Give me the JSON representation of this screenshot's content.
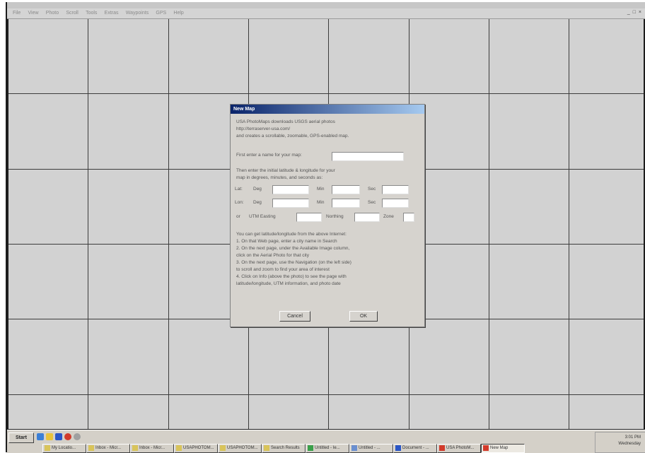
{
  "window": {
    "menu": [
      "File",
      "View",
      "Photo",
      "Scroll",
      "Tools",
      "Extras",
      "Waypoints",
      "GPS",
      "Help"
    ],
    "controls": "_ □ ×"
  },
  "dialog": {
    "title": "New Map",
    "intro": [
      "USA PhotoMaps downloads USGS aerial photos",
      "http://terraserver-usa.com/",
      "and creates a scrollable, zoomable, GPS-enabled map."
    ],
    "name_label": "First enter a name for your map:",
    "name_value": "",
    "coord_intro": [
      "Then enter the initial latitude & longitude for your",
      "map in degrees, minutes, and seconds as:"
    ],
    "lat_label": "Lat:",
    "lon_label": "Lon:",
    "deg_label": "Deg",
    "min_label": "Min",
    "sec_label": "Sec",
    "or_label": "or",
    "utm_label": "UTM Easting",
    "northing_label": "Northing",
    "zone_label": "Zone",
    "help_lines": [
      "You can get latitude/longitude from the above Internet:",
      "1. On that Web page, enter a city name in Search",
      "2. On the next page, under the Available Image column,",
      "   click on the Aerial Photo for that city",
      "3. On the next page, use the Navigation (on the left side)",
      "   to scroll and zoom to find your area of interest",
      "4. Click on Info (above the photo) to see the page with",
      "   latitude/longitude, UTM information, and photo date"
    ],
    "cancel_label": "Cancel",
    "ok_label": "OK"
  },
  "taskbar": {
    "start_label": "Start",
    "tasks": [
      "My Locatio...",
      "Inbox - Micr...",
      "Inbox - Micr...",
      "USAPHOTOM...",
      "USAPHOTOM...",
      "Search Results",
      "Untitled - Ie...",
      "Untitled - ...",
      "Document - ...",
      "USA PhotoM...",
      "New Map"
    ],
    "clock_time": "3:01 PM",
    "clock_day": "Wednesday"
  }
}
